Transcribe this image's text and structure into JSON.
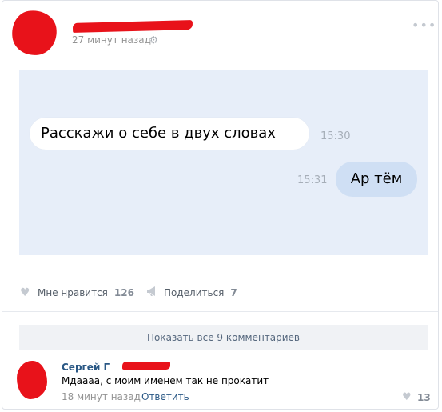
{
  "post": {
    "time": "27 минут назад",
    "more_icon": "more-dots-icon",
    "settings_icon": "gear-icon"
  },
  "chat": {
    "incoming_text": "Расскажи о себе в двух словах",
    "incoming_time": "15:30",
    "outgoing_text": "Ар тём",
    "outgoing_time": "15:31",
    "background_color": "#e7eef9",
    "outgoing_color": "#cfdff4"
  },
  "actions": {
    "like_label": "Мне нравится",
    "like_count": "126",
    "share_label": "Поделиться",
    "share_count": "7"
  },
  "comments": {
    "show_all_label": "Показать все 9 комментариев",
    "items": [
      {
        "author": "Сергей Г",
        "text": "Мдаааа, с моим именем так не прокатит",
        "time": "18 минут назад",
        "reply_label": "Ответить",
        "like_count": "13"
      }
    ]
  },
  "colors": {
    "redaction": "#e8121a",
    "link": "#2a5885"
  }
}
